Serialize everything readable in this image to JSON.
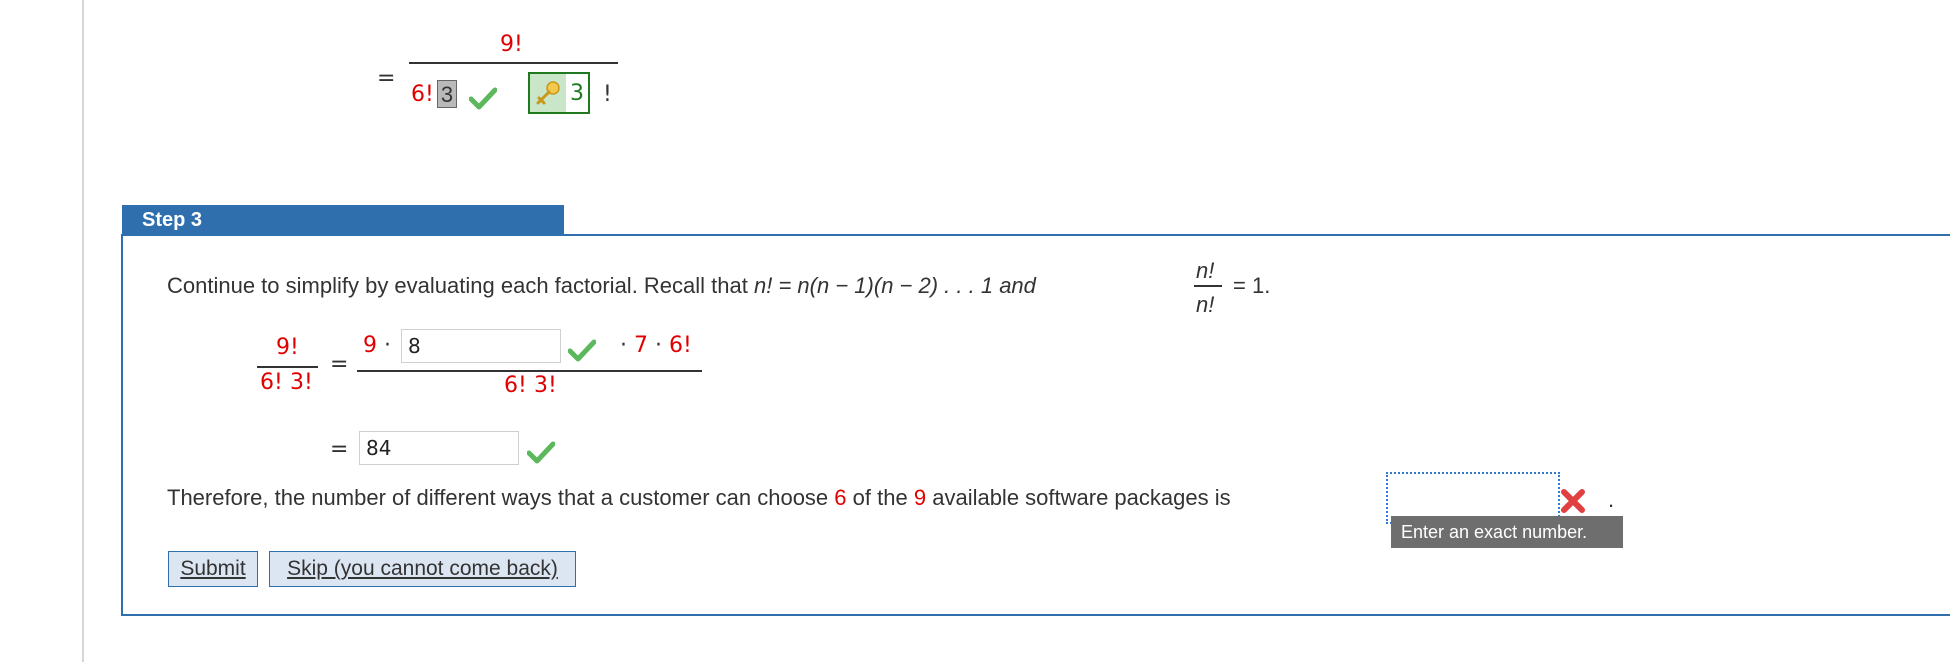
{
  "top_expression": {
    "equals": "=",
    "numerator": "9!",
    "denom_six": "6!",
    "denom_box_value": "3",
    "answer_value": "3",
    "bang": "!"
  },
  "step": {
    "header": "Step 3",
    "intro_prefix": "Continue to simplify by evaluating each factorial. Recall that",
    "intro_n": "n",
    "intro_formula": "! = n(n − 1)(n − 2) . . . 1 and",
    "frac_num": "n!",
    "frac_den": "n!",
    "intro_suffix": "= 1.",
    "lhs_num": "9!",
    "lhs_den_a": "6!",
    "lhs_den_b": "3!",
    "equals": "=",
    "rhs_num_prefix": "9 ·",
    "rhs_num_input": "8",
    "rhs_num_suffix": "· 7 · 6!",
    "rhs_den_a": "6!",
    "rhs_den_b": "3!",
    "result_equals": "=",
    "result_input": "84",
    "conclusion_a": "Therefore, the number of different ways that a customer can choose",
    "conclusion_six": "6",
    "conclusion_b": "of the",
    "conclusion_nine": "9",
    "conclusion_c": "available software packages is",
    "conclusion_input": "",
    "period": ".",
    "tooltip": "Enter an exact number."
  },
  "buttons": {
    "submit": "Submit",
    "skip": "Skip (you cannot come back)"
  },
  "colors": {
    "accent": "#2f6fad",
    "highlight_red": "#e00000",
    "check_green": "#5cb85c",
    "error_red": "#e04040"
  }
}
